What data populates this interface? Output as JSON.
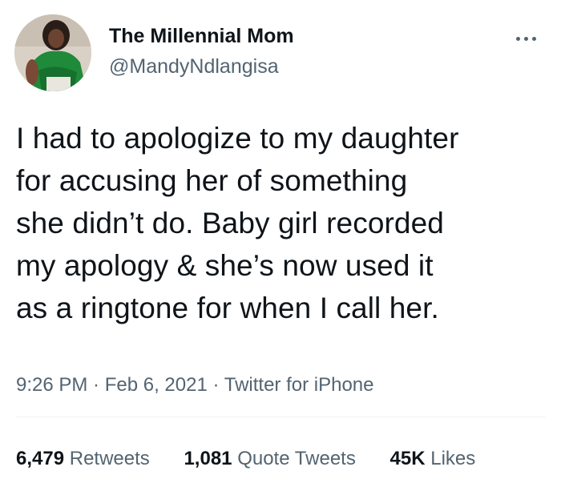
{
  "author": {
    "display_name": "The Millennial Mom",
    "handle": "@MandyNdlangisa"
  },
  "tweet": {
    "lines": [
      "I had to apologize to my daughter",
      "for accusing her of something",
      "she didn’t do. Baby girl recorded",
      "my apology & she’s now used it",
      "as a ringtone for when I call her."
    ]
  },
  "meta": {
    "time": "9:26 PM",
    "separator": " · ",
    "date": "Feb 6, 2021",
    "source": "Twitter for iPhone"
  },
  "stats": {
    "retweets": {
      "count": "6,479",
      "label": "Retweets"
    },
    "quote_tweets": {
      "count": "1,081",
      "label": "Quote Tweets"
    },
    "likes": {
      "count": "45K",
      "label": "Likes"
    }
  },
  "icons": {
    "more": "more-dots-icon",
    "avatar": "avatar"
  },
  "colors": {
    "text_primary": "#0f1419",
    "text_secondary": "#536471",
    "divider": "#eff3f4"
  }
}
